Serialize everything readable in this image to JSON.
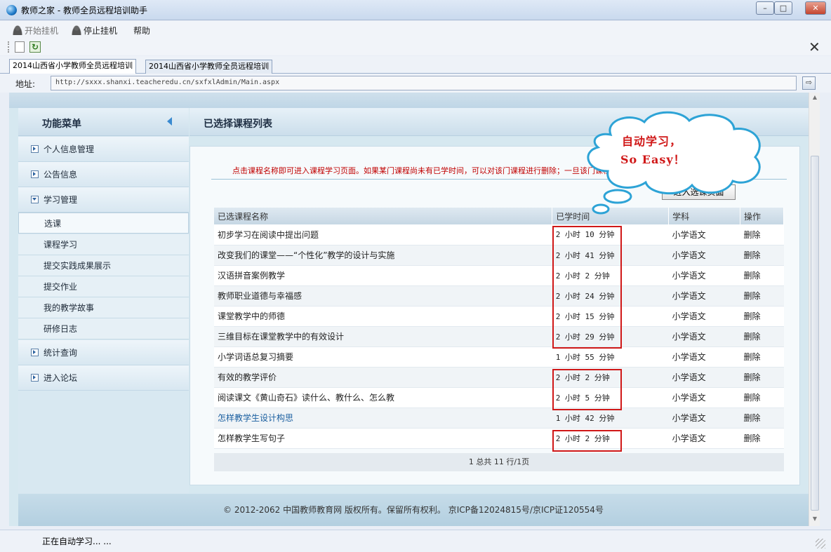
{
  "window": {
    "title": "教师之家 - 教师全员远程培训助手",
    "minimize": "–",
    "maximize": "□",
    "close": "✕"
  },
  "menu": {
    "start": "开始挂机",
    "stop": "停止挂机",
    "help": "帮助"
  },
  "toolbar": {
    "refresh_glyph": "↻",
    "close_glyph": "✕"
  },
  "tabs": [
    {
      "label": "2014山西省小学教师全员远程培训",
      "active": true
    },
    {
      "label": "2014山西省小学教师全员远程培训",
      "active": false
    }
  ],
  "address": {
    "label": "地址:",
    "url": "http://sxxx.shanxi.teacheredu.cn/sxfxlAdmin/Main.aspx",
    "go_glyph": "⇨"
  },
  "sidebar": {
    "title": "功能菜单",
    "groups": [
      {
        "label": "个人信息管理",
        "expanded": false
      },
      {
        "label": "公告信息",
        "expanded": false
      },
      {
        "label": "学习管理",
        "expanded": true
      },
      {
        "label": "统计查询",
        "expanded": false
      },
      {
        "label": "进入论坛",
        "expanded": false
      }
    ],
    "sub_items": [
      "选课",
      "课程学习",
      "提交实践成果展示",
      "提交作业",
      "我的教学故事",
      "研修日志"
    ]
  },
  "content": {
    "title": "已选择课程列表",
    "notice": "点击课程名称即可进入课程学习页面。如果某门课程尚未有已学时间，可以对该门课程进行删除；一旦该门课程已有已学时间，就无法对其进行删除。",
    "enter_button": "进入选课页面",
    "columns": [
      "已选课程名称",
      "已学时间",
      "学科",
      "操作"
    ],
    "rows": [
      {
        "name": "初步学习在阅读中提出问题",
        "time": "2 小时 10 分钟",
        "subject": "小学语文",
        "action": "删除"
      },
      {
        "name": "改变我们的课堂——“个性化”教学的设计与实施",
        "time": "2 小时 41 分钟",
        "subject": "小学语文",
        "action": "删除"
      },
      {
        "name": "汉语拼音案例教学",
        "time": "2 小时 2 分钟",
        "subject": "小学语文",
        "action": "删除"
      },
      {
        "name": "教师职业道德与幸福感",
        "time": "2 小时 24 分钟",
        "subject": "小学语文",
        "action": "删除"
      },
      {
        "name": "课堂教学中的师德",
        "time": "2 小时 15 分钟",
        "subject": "小学语文",
        "action": "删除"
      },
      {
        "name": "三维目标在课堂教学中的有效设计",
        "time": "2 小时 29 分钟",
        "subject": "小学语文",
        "action": "删除"
      },
      {
        "name": "小学词语总复习摘要",
        "time": "1 小时 55 分钟",
        "subject": "小学语文",
        "action": "删除"
      },
      {
        "name": "有效的教学评价",
        "time": "2 小时 2 分钟",
        "subject": "小学语文",
        "action": "删除"
      },
      {
        "name": "阅读课文《黄山奇石》读什么、教什么、怎么教",
        "time": "2 小时 5 分钟",
        "subject": "小学语文",
        "action": "删除"
      },
      {
        "name": "怎样教学生设计构思",
        "time": "1 小时 42 分钟",
        "subject": "小学语文",
        "action": "删除"
      },
      {
        "name": "怎样教学生写句子",
        "time": "2 小时 2 分钟",
        "subject": "小学语文",
        "action": "删除"
      }
    ],
    "pagination": "1 总共 11 行/1页"
  },
  "callout": {
    "line1": "自动学习，",
    "line2": "So Easy！"
  },
  "footer": "© 2012-2062 中国教师教育网 版权所有。保留所有权利。 京ICP备12024815号/京ICP证120554号",
  "status": "正在自动学习... ..."
}
